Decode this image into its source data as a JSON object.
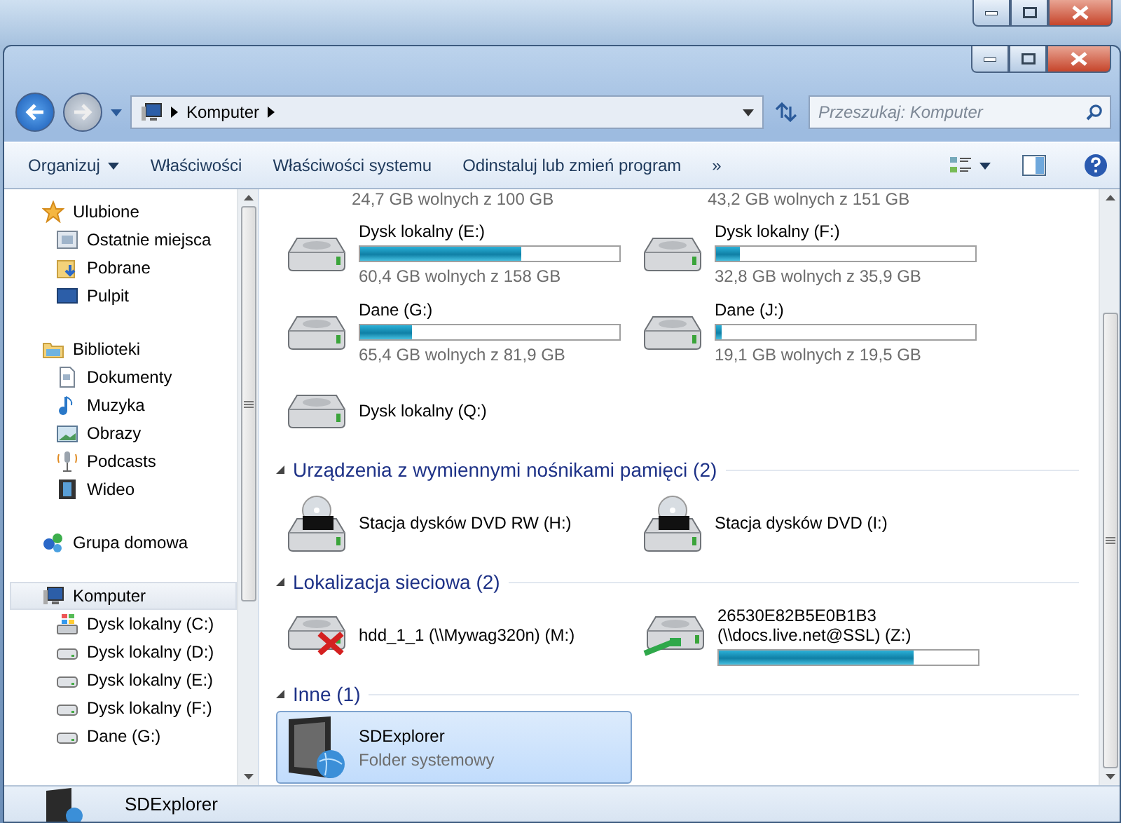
{
  "address": {
    "crumbs": [
      "Komputer"
    ]
  },
  "search": {
    "placeholder": "Przeszukaj: Komputer"
  },
  "toolbar": {
    "buttons": [
      {
        "label": "Organizuj",
        "dropdown": true
      },
      {
        "label": "Właściwości",
        "dropdown": false
      },
      {
        "label": "Właściwości systemu",
        "dropdown": false
      },
      {
        "label": "Odinstaluj lub zmień program",
        "dropdown": false
      }
    ],
    "overflow": "»"
  },
  "sidebar": {
    "groups": [
      {
        "label": "Ulubione",
        "kind": "star",
        "selected": false,
        "children": [
          {
            "label": "Ostatnie miejsca",
            "kind": "recent",
            "selected": false
          },
          {
            "label": "Pobrane",
            "kind": "download",
            "selected": false
          },
          {
            "label": "Pulpit",
            "kind": "desktop",
            "selected": false
          }
        ]
      },
      {
        "label": "Biblioteki",
        "kind": "library",
        "selected": false,
        "children": [
          {
            "label": "Dokumenty",
            "kind": "doc",
            "selected": false
          },
          {
            "label": "Muzyka",
            "kind": "music",
            "selected": false
          },
          {
            "label": "Obrazy",
            "kind": "picture",
            "selected": false
          },
          {
            "label": "Podcasts",
            "kind": "mic",
            "selected": false
          },
          {
            "label": "Wideo",
            "kind": "video",
            "selected": false
          }
        ]
      },
      {
        "label": "Grupa domowa",
        "kind": "homegroup",
        "selected": false
      },
      {
        "label": "Komputer",
        "kind": "computer",
        "selected": true,
        "children": [
          {
            "label": "Dysk lokalny (C:)",
            "kind": "windrive",
            "selected": false
          },
          {
            "label": "Dysk lokalny (D:)",
            "kind": "drive",
            "selected": false
          },
          {
            "label": "Dysk lokalny (E:)",
            "kind": "drive",
            "selected": false
          },
          {
            "label": "Dysk lokalny (F:)",
            "kind": "drive",
            "selected": false
          },
          {
            "label": "Dane (G:)",
            "kind": "drive",
            "selected": false
          }
        ]
      }
    ]
  },
  "partial_row": [
    "24,7 GB wolnych z 100 GB",
    "43,2 GB wolnych z 151 GB"
  ],
  "sections": [
    {
      "items": [
        {
          "kind": "drive",
          "name": "Dysk lokalny (E:)",
          "level": 0.62,
          "free": "60,4 GB wolnych z 158 GB",
          "selected": false
        },
        {
          "kind": "drive",
          "name": "Dysk lokalny (F:)",
          "level": 0.09,
          "free": "32,8 GB wolnych z 35,9 GB",
          "selected": false
        },
        {
          "kind": "drive",
          "name": "Dane (G:)",
          "level": 0.2,
          "free": "65,4 GB wolnych z 81,9 GB",
          "selected": false
        },
        {
          "kind": "drive",
          "name": "Dane (J:)",
          "level": 0.02,
          "free": "19,1 GB wolnych z 19,5 GB",
          "selected": false
        },
        {
          "kind": "drive",
          "name": "Dysk lokalny (Q:)",
          "selected": false
        }
      ]
    },
    {
      "title": "Urządzenia z wymiennymi nośnikami pamięci (2)",
      "items": [
        {
          "kind": "dvd",
          "name": "Stacja dysków DVD RW (H:)",
          "selected": false
        },
        {
          "kind": "dvd",
          "name": "Stacja dysków DVD (I:)",
          "selected": false
        }
      ]
    },
    {
      "title": "Lokalizacja sieciowa (2)",
      "items": [
        {
          "kind": "net-off",
          "name": "hdd_1_1 (\\\\Mywag320n) (M:)",
          "selected": false
        },
        {
          "kind": "net-on",
          "name": "26530E82B5E0B1B3 (\\\\docs.live.net@SSL) (Z:)",
          "level": 0.75,
          "selected": false
        }
      ]
    },
    {
      "title": "Inne (1)",
      "items": [
        {
          "kind": "folder",
          "name": "SDExplorer",
          "free": "Folder systemowy",
          "selected": true
        }
      ]
    }
  ],
  "details": {
    "name": "SDExplorer"
  }
}
